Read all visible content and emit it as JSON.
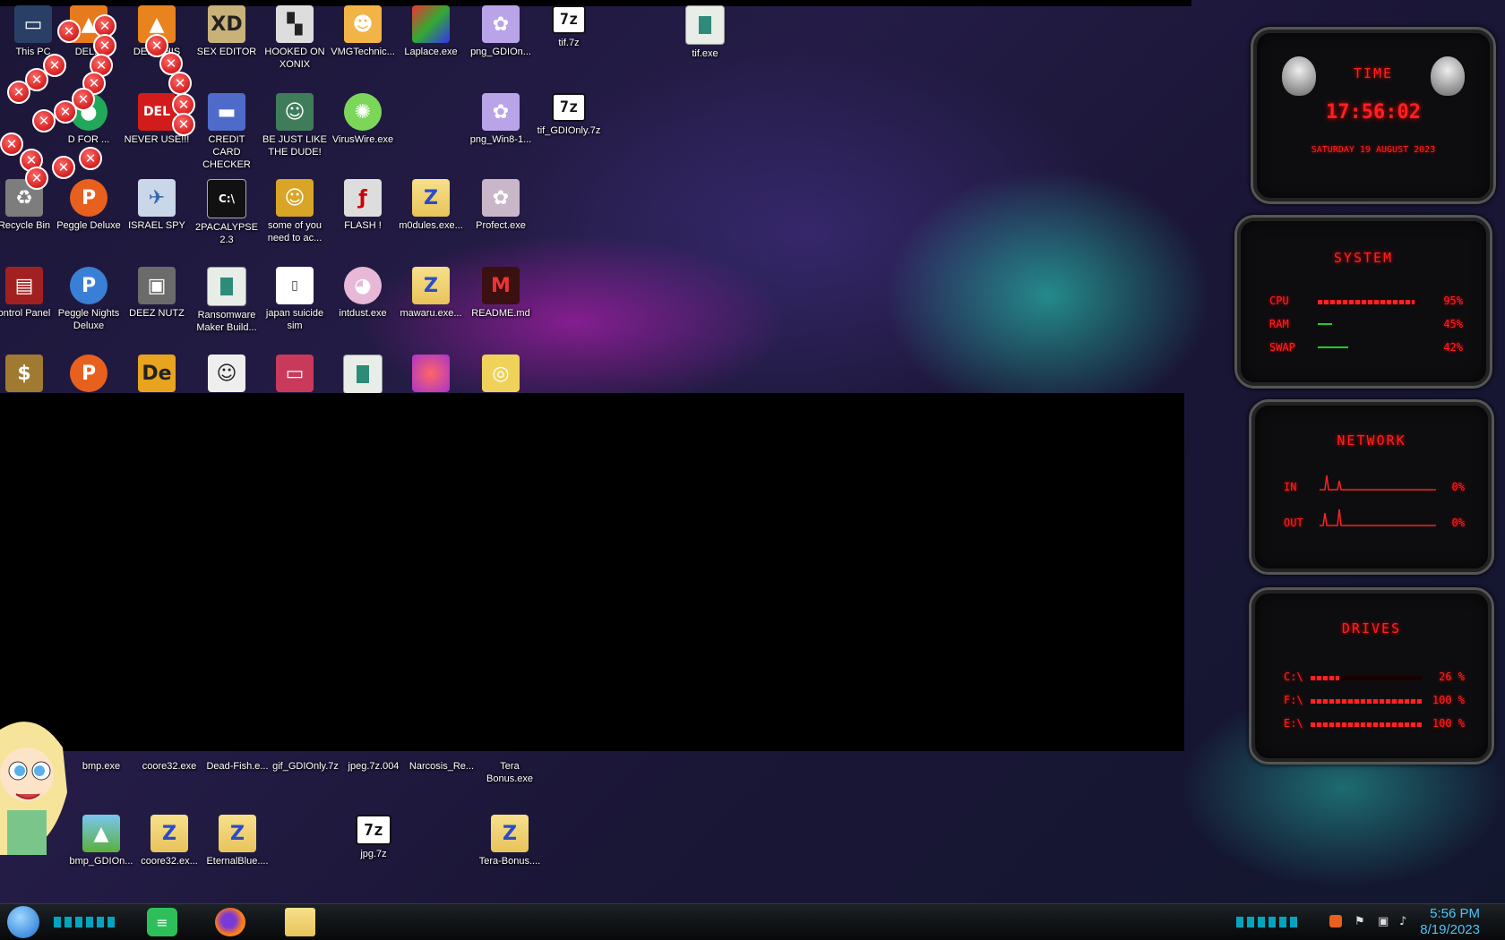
{
  "desktop_icons": {
    "row1": [
      {
        "label": "This PC",
        "icon": "this-pc-icon"
      },
      {
        "label": "DEL...",
        "icon": "vlc-icon"
      },
      {
        "label": "DE... THIS",
        "icon": "cone-icon"
      },
      {
        "label": "SEX EDITOR",
        "icon": "hex-editor-icon"
      },
      {
        "label": "HOOKED ON XONIX",
        "icon": "game-icon"
      },
      {
        "label": "VMGTechnic...",
        "icon": "user-icon"
      },
      {
        "label": "Laplace.exe",
        "icon": "laplace-icon"
      },
      {
        "label": "png_GDIOn...",
        "icon": "anime-icon"
      },
      {
        "label": "tif.7z",
        "icon": "7z-icon"
      },
      {
        "label": "tif.exe",
        "icon": "window-icon"
      }
    ],
    "row2": [
      {
        "label": "D FOR ...",
        "icon": "chat-icon"
      },
      {
        "label": "NEVER USE!!!",
        "icon": "del-icon"
      },
      {
        "label": "CREDIT CARD CHECKER",
        "icon": "card-icon"
      },
      {
        "label": "BE JUST LIKE THE DUDE!",
        "icon": "santa-icon"
      },
      {
        "label": "VirusWire.exe",
        "icon": "virus-icon"
      },
      {
        "label": "png_Win8-1...",
        "icon": "anime-icon"
      },
      {
        "label": "tif_GDIOnly.7z",
        "icon": "7z-icon"
      }
    ],
    "row3": [
      {
        "label": "Recycle Bin",
        "icon": "recycle-bin-icon"
      },
      {
        "label": "Peggle Deluxe",
        "icon": "peggle-icon"
      },
      {
        "label": "ISRAEL SPY",
        "icon": "spy-icon"
      },
      {
        "label": "2PACALYPSE 2.3",
        "icon": "terminal-icon"
      },
      {
        "label": "some of you need to ac...",
        "icon": "dog-icon"
      },
      {
        "label": "FLASH !",
        "icon": "flash-icon"
      },
      {
        "label": "m0dules.exe...",
        "icon": "zip-folder-icon"
      },
      {
        "label": "Profect.exe",
        "icon": "anime-icon"
      }
    ],
    "row4": [
      {
        "label": "ontrol Panel",
        "icon": "control-panel-icon"
      },
      {
        "label": "Peggle Nights Deluxe",
        "icon": "peggle-icon"
      },
      {
        "label": "DEEZ NUTZ",
        "icon": "cubes-icon"
      },
      {
        "label": "Ransomware Maker Build...",
        "icon": "window-icon"
      },
      {
        "label": "japan suicide sim",
        "icon": "document-icon"
      },
      {
        "label": "intdust.exe",
        "icon": "palette-icon"
      },
      {
        "label": "mawaru.exe...",
        "icon": "zip-folder-icon"
      },
      {
        "label": "README.md",
        "icon": "readme-icon"
      }
    ],
    "bottom_row1": [
      {
        "label": "bmp.exe"
      },
      {
        "label": "coore32.exe"
      },
      {
        "label": "Dead-Fish.e..."
      },
      {
        "label": "gif_GDIOnly.7z"
      },
      {
        "label": "jpeg.7z.004"
      },
      {
        "label": "Narcosis_Re..."
      },
      {
        "label": "Tera Bonus.exe"
      }
    ],
    "bottom_row2": [
      {
        "label": "bmp_GDIOn...",
        "icon": "image-icon"
      },
      {
        "label": "coore32.ex...",
        "icon": "zip-folder-icon"
      },
      {
        "label": "EternalBlue....",
        "icon": "zip-folder-icon"
      },
      {
        "label": "jpg.7z",
        "icon": "7z-icon"
      },
      {
        "label": "Tera-Bonus....",
        "icon": "zip-folder-icon"
      }
    ]
  },
  "widgets": {
    "time": {
      "title": "TIME",
      "clock": "17:56:02",
      "date": "SATURDAY 19 AUGUST 2023"
    },
    "system": {
      "title": "SYSTEM",
      "rows": [
        {
          "label": "CPU",
          "value": "95%",
          "level": 0.95
        },
        {
          "label": "RAM",
          "value": "45%",
          "level": 0.45
        },
        {
          "label": "SWAP",
          "value": "42%",
          "level": 0.42
        }
      ]
    },
    "network": {
      "title": "NETWORK",
      "rows": [
        {
          "label": "IN",
          "value": "0%"
        },
        {
          "label": "OUT",
          "value": "0%"
        }
      ]
    },
    "drives": {
      "title": "DRIVES",
      "rows": [
        {
          "label": "C:\\",
          "value": "26 %",
          "level": 0.26
        },
        {
          "label": "F:\\",
          "value": "100 %",
          "level": 1.0
        },
        {
          "label": "E:\\",
          "value": "100 %",
          "level": 1.0
        }
      ]
    }
  },
  "taskbar": {
    "time": "5:56 PM",
    "date": "8/19/2023",
    "apps": [
      "start-orb-icon",
      "notes-icon",
      "firefox-icon",
      "file-explorer-icon"
    ]
  },
  "colors": {
    "widget_red": "#ff2020",
    "clock_blue": "#4fc3f7"
  }
}
